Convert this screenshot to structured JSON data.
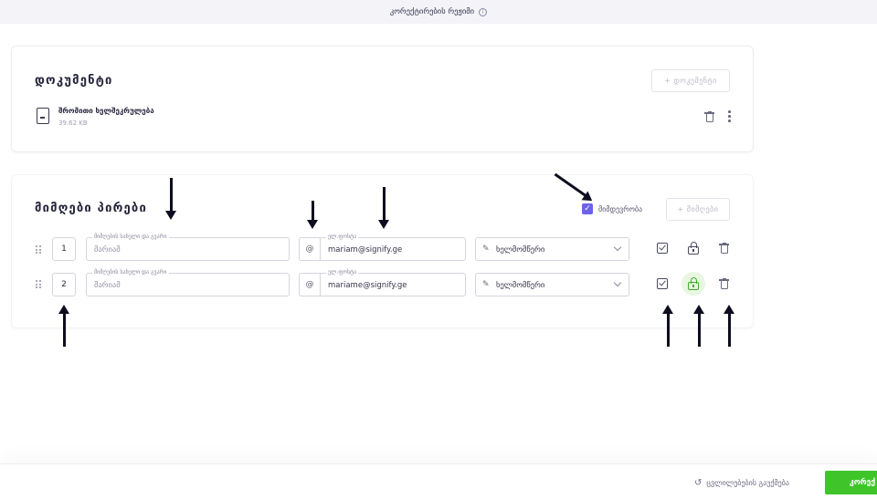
{
  "topbar": {
    "title": "კორექტირების რეჟიმი",
    "info_icon": "info-icon"
  },
  "documents": {
    "title": "დოკუმენტი",
    "add_button": "+ დოკუმენტი",
    "file": {
      "name": "შრომითი ხელშეკრულება",
      "size": "39.62 KB"
    }
  },
  "recipients": {
    "title": "მიმღები პირები",
    "order_label": "მიმდევრობა",
    "order_checked": true,
    "add_button": "+ მიმღები",
    "rows": [
      {
        "order": "1",
        "name_label": "მიმღების სახელი და გვარი",
        "name_value": "მარიამ",
        "email_label": "ელ.ფოსტა",
        "email_at": "@",
        "email_value": "mariam@signify.ge",
        "role": "ხელმომწერი",
        "lock_active": false
      },
      {
        "order": "2",
        "name_label": "მიმღების სახელი და გვარი",
        "name_value": "მარიამ",
        "email_label": "ელ.ფოსტა",
        "email_at": "@",
        "email_value": "mariame@signify.ge",
        "role": "ხელმომწერი",
        "lock_active": true
      }
    ]
  },
  "footer": {
    "reset_label": "ცვლილებების გაუქმება",
    "primary_label": "კორექ"
  },
  "colors": {
    "accent": "#6c63e8",
    "success": "#3fc52a",
    "lock_green": "#3fae2a"
  }
}
